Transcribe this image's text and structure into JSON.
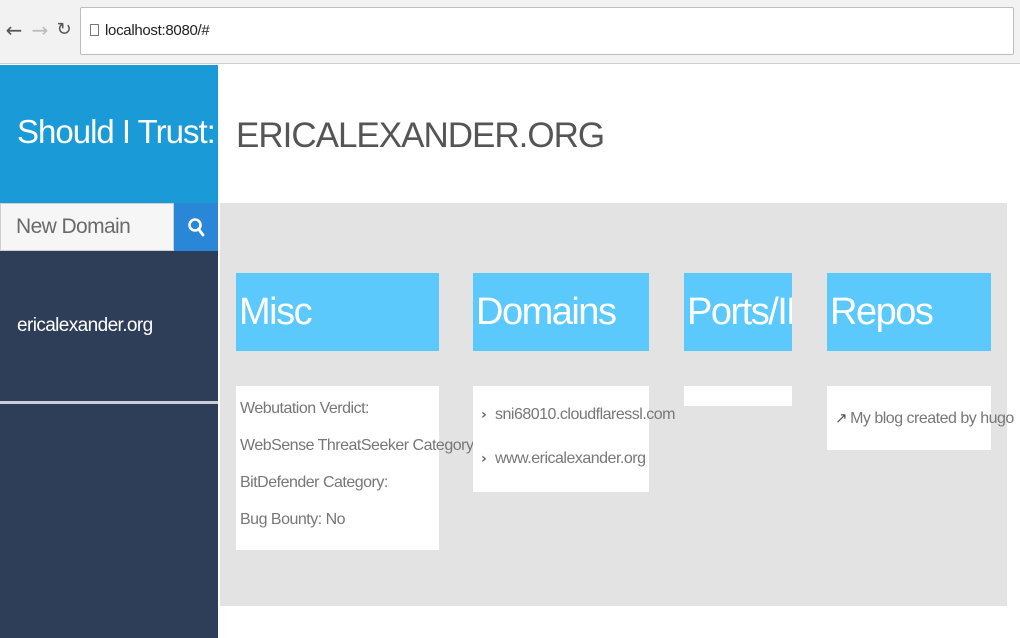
{
  "browser": {
    "url": "localhost:8080/#"
  },
  "sidebar": {
    "brand": "Should I Trust:",
    "search": {
      "placeholder": "New Domain",
      "value": ""
    },
    "domains": [
      "ericalexander.org"
    ]
  },
  "main": {
    "title": "ERICALEXANDER.ORG",
    "cards": {
      "misc": {
        "heading": "Misc",
        "rows": [
          "Webutation Verdict:",
          "WebSense ThreatSeeker Category:",
          "BitDefender Category:",
          "Bug Bounty: No"
        ]
      },
      "domains": {
        "heading": "Domains",
        "items": [
          "sni68010.cloudflaressl.com",
          "www.ericalexander.org"
        ]
      },
      "ports": {
        "heading": "Ports/IPs",
        "items": []
      },
      "repos": {
        "heading": "Repos",
        "items": [
          "My blog created by hugo"
        ]
      }
    }
  },
  "colors": {
    "brand": "#1a9bd7",
    "sidebar": "#2f3e58",
    "search_button": "#2a86d6",
    "card_header": "#5bc9fb",
    "panel_bg": "#e3e3e3"
  },
  "icons": {
    "back": "arrow-left-icon",
    "forward": "arrow-right-icon",
    "reload": "reload-icon",
    "page": "page-icon",
    "search": "search-icon",
    "chevron": "chevron-right-icon",
    "external": "external-link-icon"
  }
}
